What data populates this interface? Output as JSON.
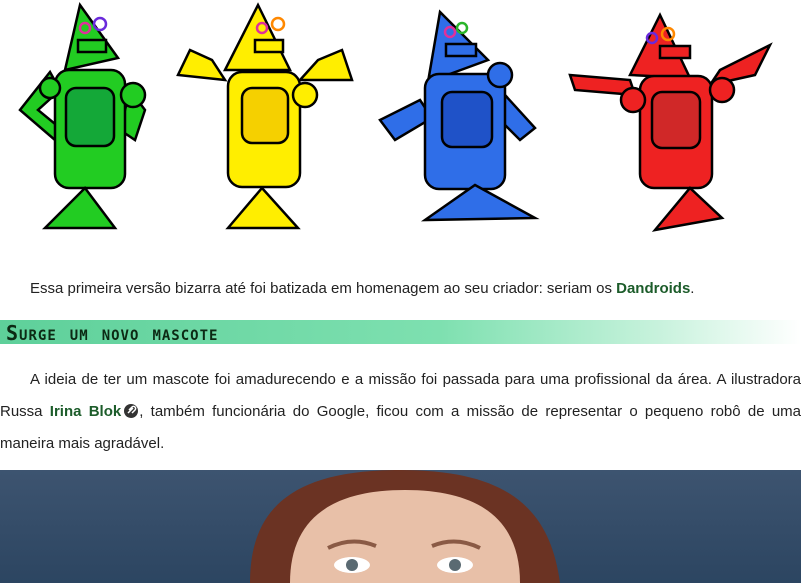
{
  "colors": {
    "green_robot": "#22cc22",
    "yellow_robot": "#ffee00",
    "blue_robot": "#2f6ee8",
    "red_robot": "#ee2222",
    "heading_gradient": "#5ed09a",
    "link_text": "#1c5c2a"
  },
  "intro": {
    "text_before": "Essa primeira versão bizarra até foi batizada em homenagem ao seu criador: seriam os ",
    "dandroids": "Dandroids",
    "text_after": "."
  },
  "section": {
    "heading": "Surge um novo mascote"
  },
  "body": {
    "text_1": "A ideia de ter um mascote foi amadurecendo e a missão foi passada para uma profissional da área. A ilustradora Russa ",
    "irina": "Irina Blok",
    "link_icon": "link-icon",
    "text_2": ", também funcionária do Google, ficou com a missão de representar o pequeno robô de uma maneira mais agradável."
  },
  "photo": {
    "subject": "photo-of-irina-blok"
  }
}
